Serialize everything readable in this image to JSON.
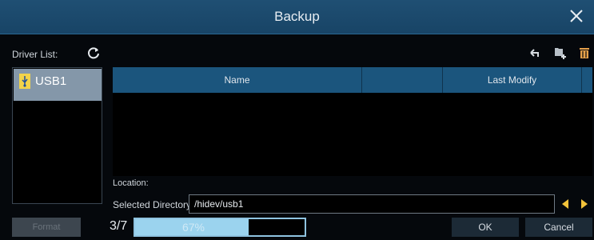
{
  "window": {
    "title": "Backup"
  },
  "icons": {
    "close": "close-icon",
    "refresh": "refresh-icon",
    "back": "back-arrow-icon",
    "new_folder": "new-folder-icon",
    "delete": "trash-icon",
    "usb": "usb-icon",
    "prev": "triangle-left-icon",
    "next": "triangle-right-icon"
  },
  "driver_list": {
    "label": "Driver List:",
    "items": [
      {
        "label": "USB1",
        "selected": true
      }
    ]
  },
  "table": {
    "columns": [
      "Name",
      "",
      "Last Modify",
      ""
    ],
    "rows": []
  },
  "location": {
    "label": "Location:",
    "selected_label": "Selected Directory:",
    "directory": "/hidev/usb1"
  },
  "footer": {
    "format_label": "Format",
    "format_enabled": false,
    "page_count": "3/7",
    "progress_percent": 67,
    "progress_text": "67%",
    "ok_label": "OK",
    "cancel_label": "Cancel"
  },
  "colors": {
    "title_bar": "#1b4a6d",
    "header": "#1b557d",
    "selected_item": "#8497a9",
    "progress": "#9bd3ee"
  }
}
